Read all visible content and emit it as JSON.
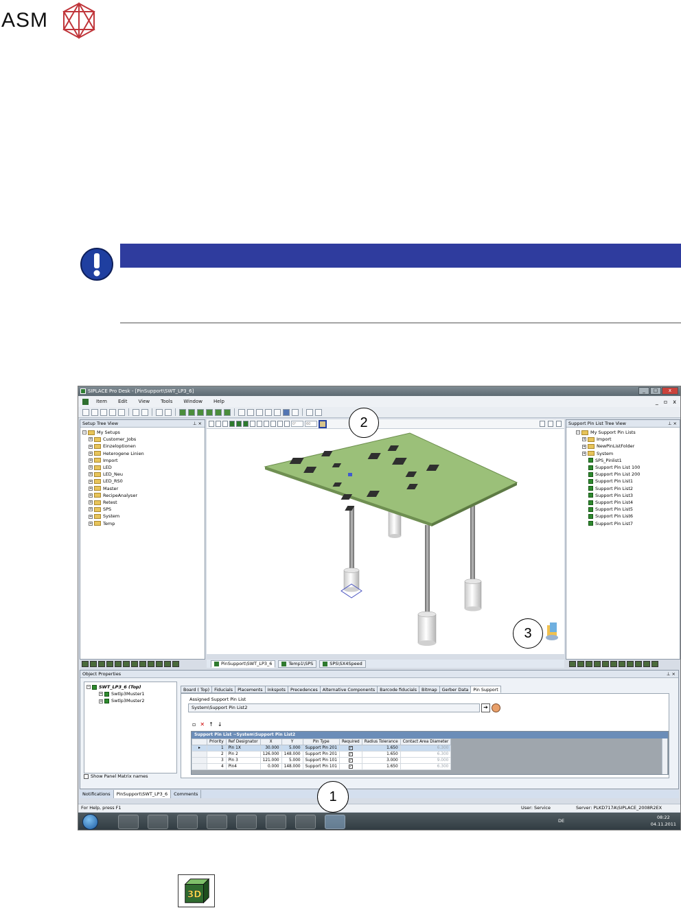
{
  "brand": {
    "logo_text": "ASM"
  },
  "window": {
    "title": "SIPLACE Pro Desk - [PinSupport\\SWT_LP3_6]",
    "controls": [
      "_",
      "□",
      "x"
    ],
    "mdi_controls": [
      "_",
      "▫",
      "x"
    ]
  },
  "menu": [
    "Item",
    "Edit",
    "View",
    "Tools",
    "Window",
    "Help"
  ],
  "setup_tree": {
    "title": "Setup Tree View",
    "root": "My Setups",
    "items": [
      "Customer_Jobs",
      "Einzeloptionen",
      "Heterogene Linien",
      "Import",
      "LED",
      "LED_Neu",
      "LED_RS0",
      "Master",
      "RecipeAnalyser",
      "Retest",
      "SPS",
      "System",
      "Temp"
    ]
  },
  "pin_tree": {
    "title": "Support Pin List Tree View",
    "root": "My Support Pin Lists",
    "folders": [
      "Import",
      "NewPinListFolder",
      "System"
    ],
    "lists": [
      "SPS_Pinlist1",
      "Support Pin List 100",
      "Support Pin List 200",
      "Support Pin List1",
      "Support Pin List2",
      "Support Pin List3",
      "Support Pin List4",
      "Support Pin List5",
      "Support Pin List6",
      "Support Pin List7"
    ]
  },
  "view_toolbar": {
    "angle": "0°",
    "zoom": "60"
  },
  "doc_tabs": [
    "PinSupport\\SWT_LP3_6",
    "Temp1\\SPS",
    "SPS\\SX4Speed"
  ],
  "object_properties": {
    "title": "Object Properties",
    "tree_root": "SWT_LP3_6 (Top)",
    "tree_children": [
      "Swtlp3Muster1",
      "Swtlp3Muster2"
    ],
    "show_matrix_label": "Show Panel Matrix names",
    "tabs": [
      "Board ( Top)",
      "Fiducials",
      "Placements",
      "Inkspots",
      "Precedences",
      "Alternative Components",
      "Barcode fiducials",
      "Bitmap",
      "Gerber Data",
      "Pin Support"
    ],
    "assigned_label": "Assigned Support Pin List",
    "assigned_value": "System\\Support Pin List2",
    "grid_title": "Support Pin List ~System\\Support Pin List2",
    "columns": [
      "Priority",
      "Ref Designator",
      "X",
      "Y",
      "Pin Type",
      "Required",
      "Radius Tolerance",
      "Contact Area Diameter"
    ],
    "rows": [
      {
        "priority": "1",
        "ref": "Pin 1X",
        "x": "30.000",
        "y": "5.000",
        "type": "Support Pin 201",
        "tol": "1.650",
        "dia": "6.300"
      },
      {
        "priority": "2",
        "ref": "Pin 2",
        "x": "126.000",
        "y": "148.000",
        "type": "Support Pin 201",
        "tol": "1.650",
        "dia": "6.300"
      },
      {
        "priority": "3",
        "ref": "Pin 3",
        "x": "121.000",
        "y": "5.000",
        "type": "Support Pin 101",
        "tol": "3.000",
        "dia": "9.000"
      },
      {
        "priority": "4",
        "ref": "Pin4",
        "x": "0.000",
        "y": "148.000",
        "type": "Support Pin 101",
        "tol": "1.650",
        "dia": "6.300"
      }
    ]
  },
  "bottom_tabs": [
    "Notifications",
    "PinSupport\\SWT_LP3_6",
    "Comments"
  ],
  "status": {
    "help": "For Help, press F1",
    "user": "User:  Service",
    "server": "Server:  PLKD717A\\SIPLACE_2008R2EX"
  },
  "taskbar": {
    "lang": "DE",
    "time": "08:22",
    "date": "04.11.2011"
  },
  "callouts": [
    "1",
    "2",
    "3"
  ],
  "icon_3d_label": "3D",
  "colors": {
    "notice_bar": "#2f3c9e",
    "notice_icon": "#1f3fa0",
    "board": "#8fb36a"
  }
}
